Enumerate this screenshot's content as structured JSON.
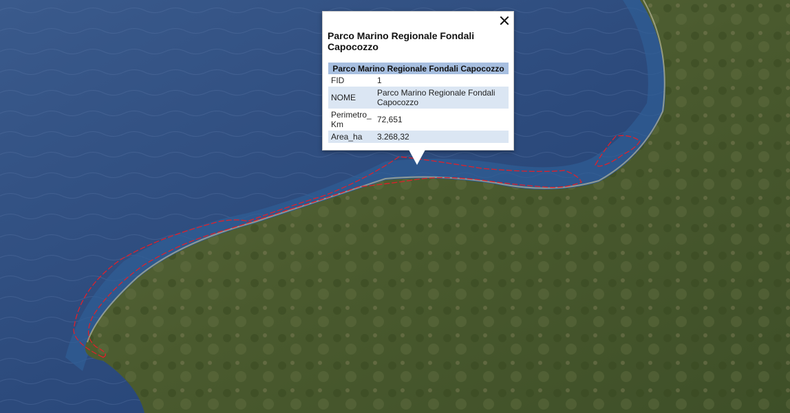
{
  "map": {
    "type": "satellite",
    "boundary_color": "#e0202a"
  },
  "popup": {
    "title": "Parco Marino Regionale Fondali Capocozzo",
    "table_header": "Parco Marino Regionale Fondali Capocozzo",
    "rows": [
      {
        "key": "FID",
        "value": "1"
      },
      {
        "key": "NOME",
        "value": "Parco Marino Regionale Fondali Capocozzo"
      },
      {
        "key": "Perimetro_ Km",
        "value": "72,651"
      },
      {
        "key": "Area_ha",
        "value": "3.268,32"
      }
    ],
    "close_icon": "close-icon"
  }
}
